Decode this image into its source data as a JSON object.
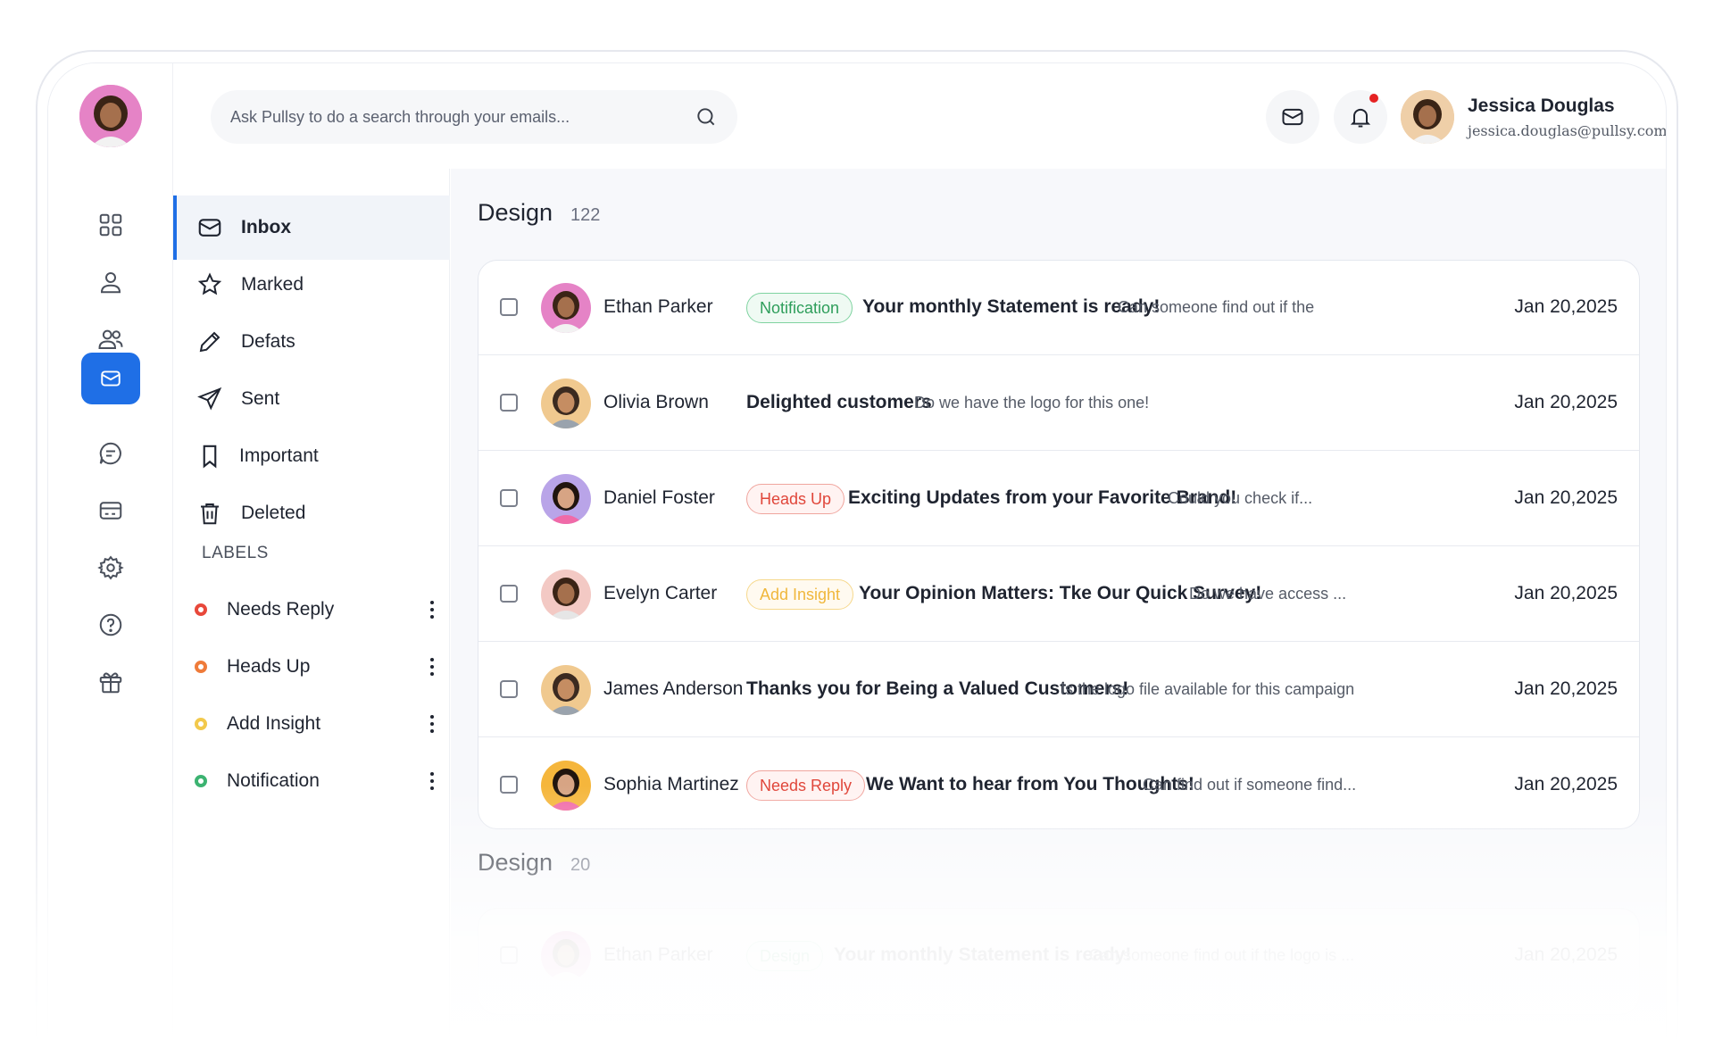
{
  "search": {
    "placeholder": "Ask Pullsy to do a search through your emails..."
  },
  "user": {
    "name": "Jessica Douglas",
    "email": "jessica.douglas@pullsy.com"
  },
  "rail": {
    "items": [
      "dashboard-icon",
      "user-icon",
      "users-icon",
      "mail-icon",
      "chat-icon",
      "card-icon",
      "settings-icon",
      "help-icon",
      "gift-icon"
    ],
    "active": 3,
    "accent": "#1f6fe6"
  },
  "mailnav": {
    "items": [
      {
        "label": "Inbox",
        "icon": "mail-icon"
      },
      {
        "label": "Marked",
        "icon": "star-icon"
      },
      {
        "label": "Defats",
        "icon": "pencil-icon"
      },
      {
        "label": "Sent",
        "icon": "send-icon"
      },
      {
        "label": "Important",
        "icon": "bookmark-icon"
      },
      {
        "label": "Deleted",
        "icon": "trash-icon"
      }
    ],
    "labels_heading": "LABELS",
    "labels": [
      {
        "label": "Needs Reply",
        "color": "#e8483b"
      },
      {
        "label": "Heads Up",
        "color": "#ef7b3a"
      },
      {
        "label": "Add Insight",
        "color": "#f2c94c"
      },
      {
        "label": "Notification",
        "color": "#3cb371"
      }
    ]
  },
  "sections": [
    {
      "title": "Design",
      "count": "122",
      "rows": [
        {
          "sender": "Ethan Parker",
          "tag": "Notification",
          "subject": "Your monthly Statement is ready!",
          "preview": "Can someone find out if the",
          "date": "Jan 20,2025"
        },
        {
          "sender": "Olivia Brown",
          "tag": "",
          "subject": "Delighted customers",
          "preview": "Do we have the logo for this one!",
          "date": "Jan 20,2025"
        },
        {
          "sender": "Daniel Foster",
          "tag": "Heads Up",
          "subject": "Exciting Updates from your Favorite Brand!",
          "preview": "Could you check if...",
          "date": "Jan 20,2025"
        },
        {
          "sender": "Evelyn Carter",
          "tag": "Add Insight",
          "subject": "Your Opinion Matters: Tke Our Quick Survey!",
          "preview": "Do we have access ...",
          "date": "Jan 20,2025"
        },
        {
          "sender": "James Anderson",
          "tag": "",
          "subject": "Thanks you for Being a Valued Customers!",
          "preview": "Is the logo file available for this campaign",
          "date": "Jan 20,2025"
        },
        {
          "sender": "Sophia Martinez",
          "tag": "Needs Reply",
          "subject": "We Want to hear from You Thoughts!",
          "preview": "Can  find out if someone find...",
          "date": "Jan 20,2025"
        }
      ]
    },
    {
      "title": "Design",
      "count": "20",
      "rows": [
        {
          "sender": "Ethan Parker",
          "tag": "Design",
          "subject": "Your monthly Statement is ready!",
          "preview": "Can someone find out if the logo is ...",
          "date": "Jan 20,2025"
        }
      ]
    }
  ],
  "tag_colors": {
    "Notification": {
      "fg": "#2e9e5b",
      "border": "#7fd3a0",
      "bg": "#effaf3"
    },
    "Heads Up": {
      "fg": "#e0463a",
      "border": "#f0a59e",
      "bg": "#fff3f2"
    },
    "Add Insight": {
      "fg": "#f0b73c",
      "border": "#f6d88c",
      "bg": "#fffaf0"
    },
    "Needs Reply": {
      "fg": "#e0463a",
      "border": "#f0a59e",
      "bg": "#fff3f2"
    },
    "Design": {
      "fg": "#2e9e5b",
      "border": "#7fd3a0",
      "bg": "#effaf3"
    }
  }
}
